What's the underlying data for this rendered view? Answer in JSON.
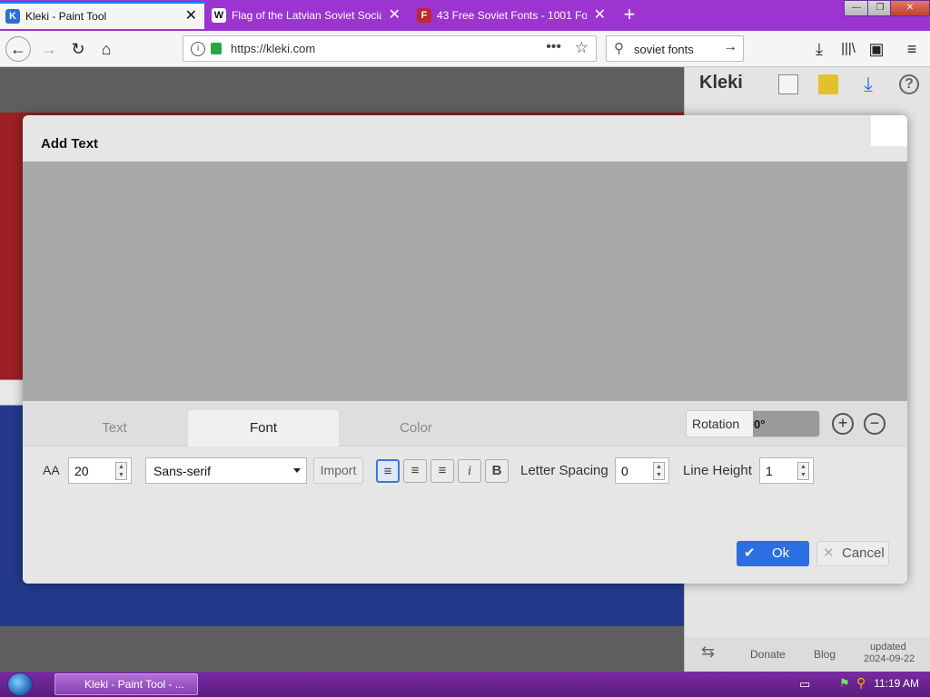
{
  "browser": {
    "tabs": [
      {
        "title": "Kleki - Paint Tool",
        "favicon": "K",
        "active": true
      },
      {
        "title": "Flag of the Latvian Soviet Socia",
        "favicon": "W",
        "active": false
      },
      {
        "title": "43 Free Soviet Fonts - 1001 Font",
        "favicon": "F",
        "active": false
      }
    ],
    "url": "https://kleki.com",
    "search_query": "soviet fonts",
    "new_tab_symbol": "+"
  },
  "right_panel": {
    "logo": "Kleki",
    "footer": {
      "donate": "Donate",
      "blog": "Blog",
      "updated_label": "updated",
      "updated_date": "2024-09-22"
    }
  },
  "modal": {
    "title": "Add Text",
    "tabs": [
      "Text",
      "Font",
      "Color"
    ],
    "active_tab": "Font",
    "rotation": {
      "label": "Rotation",
      "value": "0°"
    },
    "size_label": "AA",
    "size_value": "20",
    "font_select": "Sans-serif",
    "import_label": "Import",
    "letter_spacing": {
      "label": "Letter Spacing",
      "value": "0"
    },
    "line_height": {
      "label": "Line Height",
      "value": "1"
    },
    "ok_label": "Ok",
    "cancel_label": "Cancel"
  },
  "taskbar": {
    "task_label": "Kleki - Paint Tool - ...",
    "clock": "11:19 AM"
  },
  "colors": {
    "browser_tabbar": "#9b34d0",
    "primary_button": "#2d6fe2",
    "flag_red": "#9c1f24",
    "flag_blue": "#233a8a"
  }
}
